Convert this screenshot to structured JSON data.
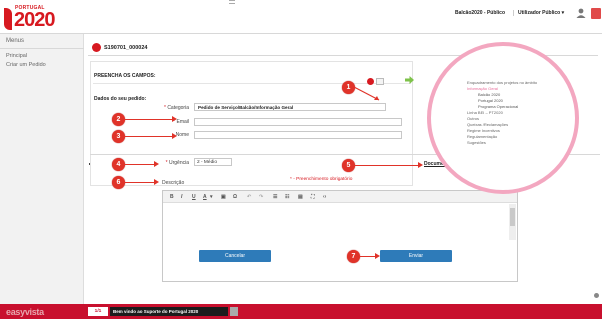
{
  "header": {
    "logo_small": "PORTUGAL",
    "logo_big": "2020",
    "balcao_selector": "Balcão2020 - Público",
    "user_selector": "Utilizador Público ▾"
  },
  "sidebar": {
    "title": "Menus",
    "items": [
      {
        "label": "Principal"
      },
      {
        "label": "Criar um Pedido"
      }
    ]
  },
  "request": {
    "id": "S190701_000024"
  },
  "form": {
    "fill_fields": "PREENCHA OS CAMPOS:",
    "your_data": "Dados do seu pedido:",
    "category_label": "Categoria",
    "category_value": "Pedido de Serviço/Balcão/Informação Geral",
    "email_label": "Email",
    "email_value": "",
    "name_label": "Nome",
    "name_value": "",
    "required_note": "* - Preenchimento obrigatório",
    "urgency_label": "Urgência",
    "urgency_value": "2 - Médio",
    "documents_label": "Documentos",
    "documents_count": "0",
    "description_label": "Descrição",
    "cancel_button": "Cancelar",
    "send_button": "Enviar"
  },
  "editor_toolbar": [
    "B",
    "I",
    "U",
    "A",
    "▾",
    "▣",
    "Ω",
    "↶",
    "↷",
    "☰",
    "☷",
    "▤",
    "⛶",
    "‹›"
  ],
  "markers": [
    "1",
    "2",
    "3",
    "4",
    "5",
    "6",
    "7"
  ],
  "category_tree": {
    "items": [
      {
        "label": "Enquadramento dos projetos no âmbito",
        "level": 0,
        "pink": false
      },
      {
        "label": "Informação Geral",
        "level": 0,
        "pink": true
      },
      {
        "label": "Balcão 2020",
        "level": 1,
        "pink": false
      },
      {
        "label": "Portugal 2020",
        "level": 1,
        "pink": false
      },
      {
        "label": "Programa Operacional",
        "level": 1,
        "pink": false
      },
      {
        "label": "Linha BEI – PT2020",
        "level": 0,
        "pink": false
      },
      {
        "label": "Outros",
        "level": 0,
        "pink": false
      },
      {
        "label": "Queixas /Reclamações",
        "level": 0,
        "pink": false
      },
      {
        "label": "Regime Incentivos",
        "level": 0,
        "pink": false
      },
      {
        "label": "Regulamentação",
        "level": 0,
        "pink": false
      },
      {
        "label": "Sugestões",
        "level": 0,
        "pink": false
      }
    ]
  },
  "footer": {
    "brand": "easyvista",
    "page_badge": "1/1",
    "ticker": "Bem vindo ao Suporte do Portugal 2020"
  },
  "colors": {
    "brand_red": "#d71920",
    "marker_red": "#e03329",
    "button_blue": "#2e7bb9",
    "highlight_pink": "#f3a7c0"
  }
}
